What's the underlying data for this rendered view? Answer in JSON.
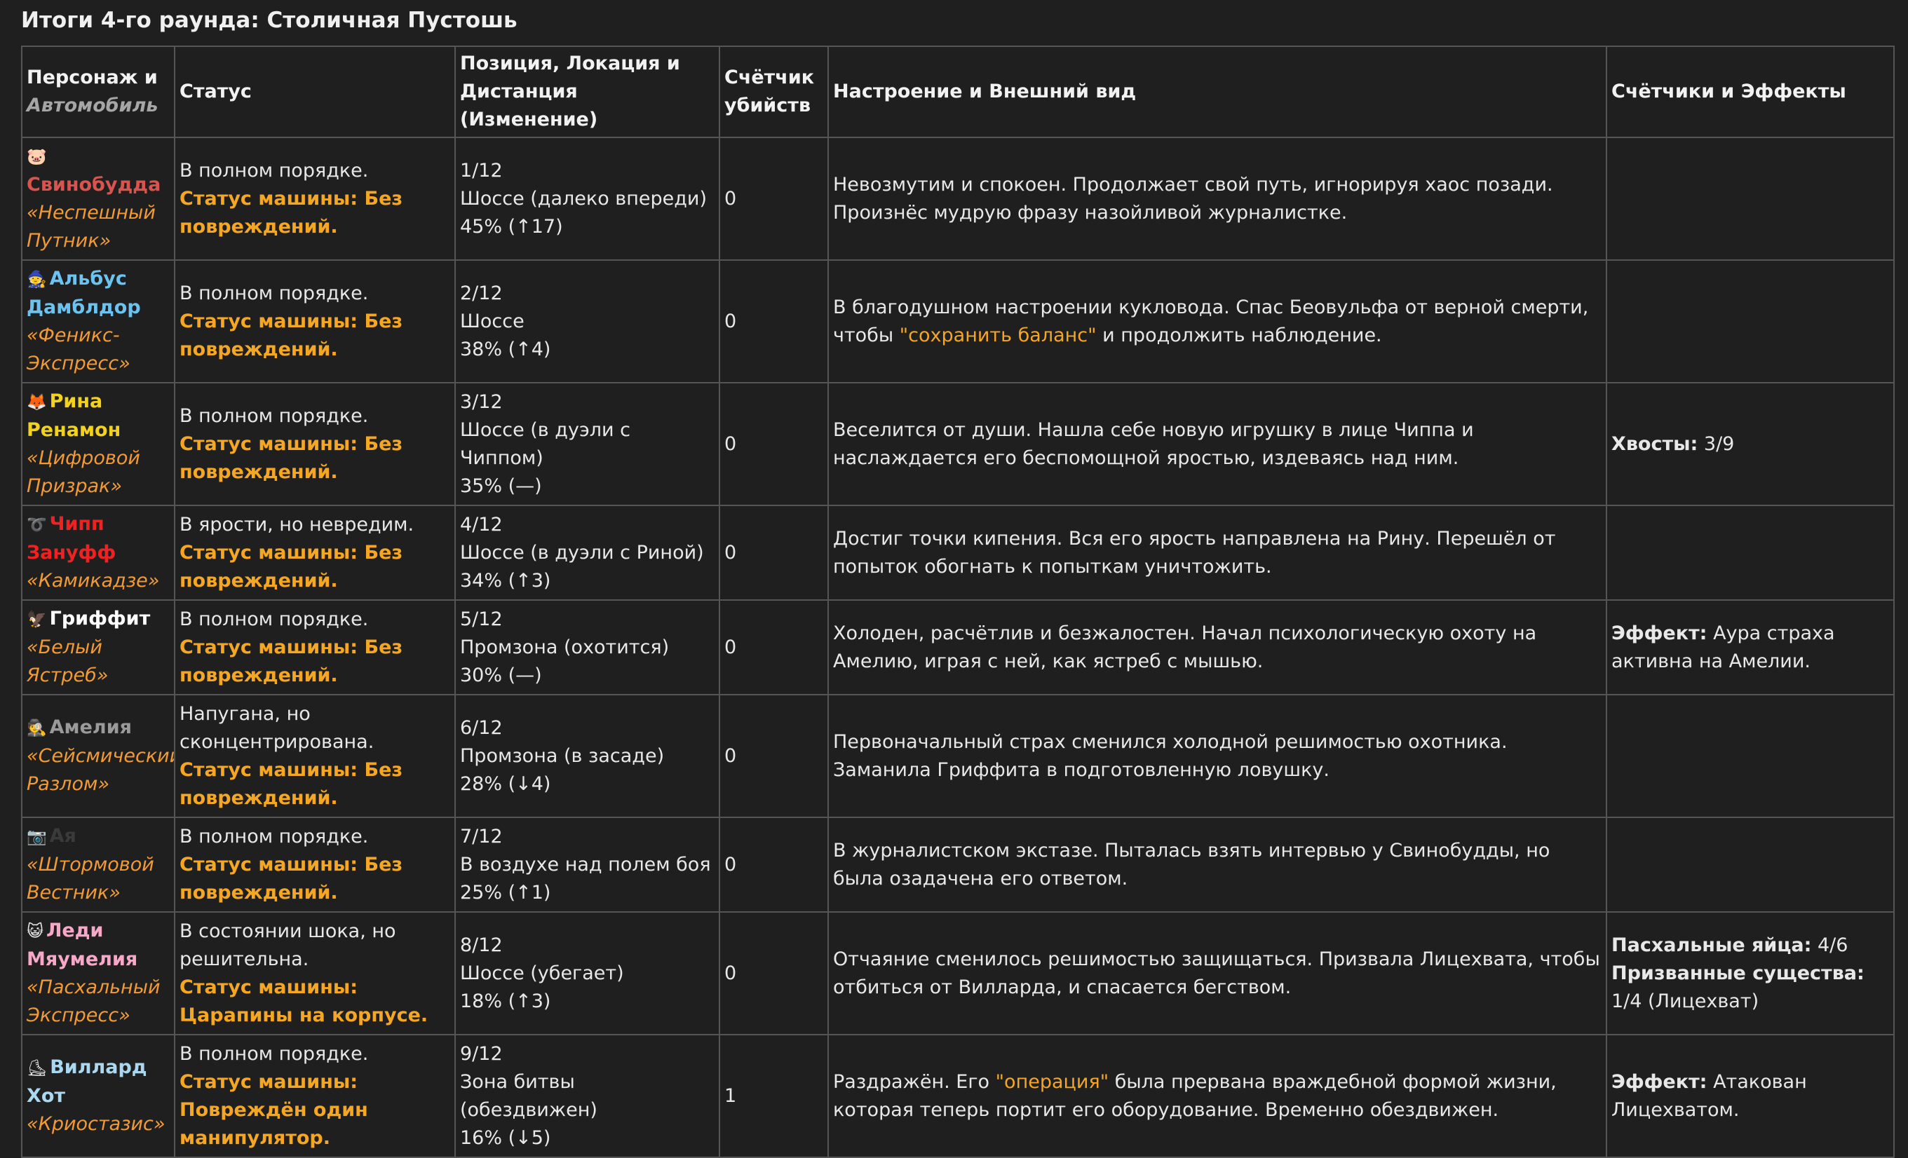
{
  "title": "Итоги 4-го раунда: Столичная Пустошь",
  "headers": {
    "char_main": "Персонаж и",
    "char_sub": "Автомобиль",
    "status": "Статус",
    "position": "Позиция, Локация и Дистанция (Изменение)",
    "kills": "Счётчик убийств",
    "mood": "Настроение и Внешний вид",
    "effects": "Счётчики и Эффекты"
  },
  "rows": [
    {
      "icon": "🐷",
      "icon_name": "pig-icon",
      "name_color": "#d9534f",
      "name": "Свинобудда",
      "car": "«Неспешный Путник»",
      "status": "В полном порядке.",
      "car_status": "Статус машины: Без повреждений.",
      "pos_rank": "1/12",
      "pos_loc": "Шоссе (далеко впереди)",
      "pos_dist": "45% (↑17)",
      "kills": "0",
      "mood_before": "Невозмутим и спокоен. Продолжает свой путь, игнорируя хаос позади. Произнёс мудрую фразу назойливой журналистке.",
      "mood_quote": "",
      "mood_after": "",
      "effects": []
    },
    {
      "icon": "🧙",
      "icon_name": "wizard-icon",
      "name_color": "#6cc3f0",
      "name": "Альбус Дамблдор",
      "car": "«Феникс-Экспресс»",
      "status": "В полном порядке.",
      "car_status": "Статус машины: Без повреждений.",
      "pos_rank": "2/12",
      "pos_loc": "Шоссе",
      "pos_dist": "38% (↑4)",
      "kills": "0",
      "mood_before": "В благодушном настроении кукловода. Спас Беовульфа от верной смерти, чтобы ",
      "mood_quote": "\"сохранить баланс\"",
      "mood_after": " и продолжить наблюдение.",
      "effects": []
    },
    {
      "icon": "🦊",
      "icon_name": "fox-icon",
      "name_color": "#f2d21b",
      "name": "Рина Ренамон",
      "car": "«Цифровой Призрак»",
      "status": "В полном порядке.",
      "car_status": "Статус машины: Без повреждений.",
      "pos_rank": "3/12",
      "pos_loc": "Шоссе (в дуэли с Чиппом)",
      "pos_dist": "35% (—)",
      "kills": "0",
      "mood_before": "Веселится от души. Нашла себе новую игрушку в лице Чиппа и наслаждается его беспомощной яростью, издеваясь над ним.",
      "mood_quote": "",
      "mood_after": "",
      "effects": [
        {
          "label": "Хвосты:",
          "value": " 3/9"
        }
      ]
    },
    {
      "icon": "➰",
      "icon_name": "loop-icon",
      "name_color": "#ee2222",
      "name": "Чипп Зануфф",
      "car": "«Камикадзе»",
      "status": "В ярости, но невредим.",
      "car_status": "Статус машины: Без повреждений.",
      "pos_rank": "4/12",
      "pos_loc": "Шоссе (в дуэли с Риной)",
      "pos_dist": "34% (↑3)",
      "kills": "0",
      "mood_before": "Достиг точки кипения. Вся его ярость направлена на Рину. Перешёл от попыток обогнать к попыткам уничтожить.",
      "mood_quote": "",
      "mood_after": "",
      "effects": []
    },
    {
      "icon": "🦅",
      "icon_name": "eagle-icon",
      "name_color": "#ffffff",
      "name": "Гриффит",
      "car": "«Белый Ястреб»",
      "status": "В полном порядке.",
      "car_status": "Статус машины: Без повреждений.",
      "pos_rank": "5/12",
      "pos_loc": "Промзона (охотится)",
      "pos_dist": "30% (—)",
      "kills": "0",
      "mood_before": "Холоден, расчётлив и безжалостен. Начал психологическую охоту на Амелию, играя с ней, как ястреб с мышью.",
      "mood_quote": "",
      "mood_after": "",
      "effects": [
        {
          "label": "Эффект:",
          "value": " Аура страха активна на Амелии."
        }
      ]
    },
    {
      "icon": "🕵",
      "icon_name": "detective-icon",
      "name_color": "#9a9a9a",
      "name": "Амелия",
      "car": "«Сейсмический Разлом»",
      "status": "Напугана, но сконцентрирована.",
      "car_status": "Статус машины: Без повреждений.",
      "pos_rank": "6/12",
      "pos_loc": "Промзона (в засаде)",
      "pos_dist": "28% (↓4)",
      "kills": "0",
      "mood_before": "Первоначальный страх сменился холодной решимостью охотника. Заманила Гриффита в подготовленную ловушку.",
      "mood_quote": "",
      "mood_after": "",
      "effects": []
    },
    {
      "icon": "📷",
      "icon_name": "camera-icon",
      "name_color": "#3a3a3a",
      "name": "Ая",
      "car": "«Штормовой Вестник»",
      "status": "В полном порядке.",
      "car_status": "Статус машины: Без повреждений.",
      "pos_rank": "7/12",
      "pos_loc": "В воздухе над полем боя",
      "pos_dist": "25% (↑1)",
      "kills": "0",
      "mood_before": "В журналистском экстазе. Пыталась взять интервью у Свинобудды, но была озадачена его ответом.",
      "mood_quote": "",
      "mood_after": "",
      "effects": []
    },
    {
      "icon": "😺",
      "icon_name": "cat-icon",
      "name_color": "#f7a8c8",
      "name": "Леди Мяумелия",
      "car": "«Пасхальный Экспресс»",
      "status": "В состоянии шока, но решительна.",
      "car_status": "Статус машины: Царапины на корпусе.",
      "pos_rank": "8/12",
      "pos_loc": "Шоссе (убегает)",
      "pos_dist": "18% (↑3)",
      "kills": "0",
      "mood_before": "Отчаяние сменилось решимостью защищаться. Призвала Лицехвата, чтобы отбиться от Вилларда, и спасается бегством.",
      "mood_quote": "",
      "mood_after": "",
      "effects": [
        {
          "label": "Пасхальные яйца:",
          "value": " 4/6"
        },
        {
          "label": "Призванные существа:",
          "value": " 1/4 (Лицехват)"
        }
      ]
    },
    {
      "icon": "⛸",
      "icon_name": "skate-icon",
      "name_color": "#a9d8f0",
      "name": "Виллард Хот",
      "car": "«Криостазис»",
      "status": "В полном порядке.",
      "car_status": "Статус машины: Повреждён один манипулятор.",
      "pos_rank": "9/12",
      "pos_loc": "Зона битвы (обездвижен)",
      "pos_dist": "16% (↓5)",
      "kills": "1",
      "mood_before": "Раздражён. Его ",
      "mood_quote": "\"операция\"",
      "mood_after": " была прервана враждебной формой жизни, которая теперь портит его оборудование. Временно обездвижен.",
      "effects": [
        {
          "label": "Эффект:",
          "value": " Атакован Лицехватом."
        }
      ]
    }
  ]
}
